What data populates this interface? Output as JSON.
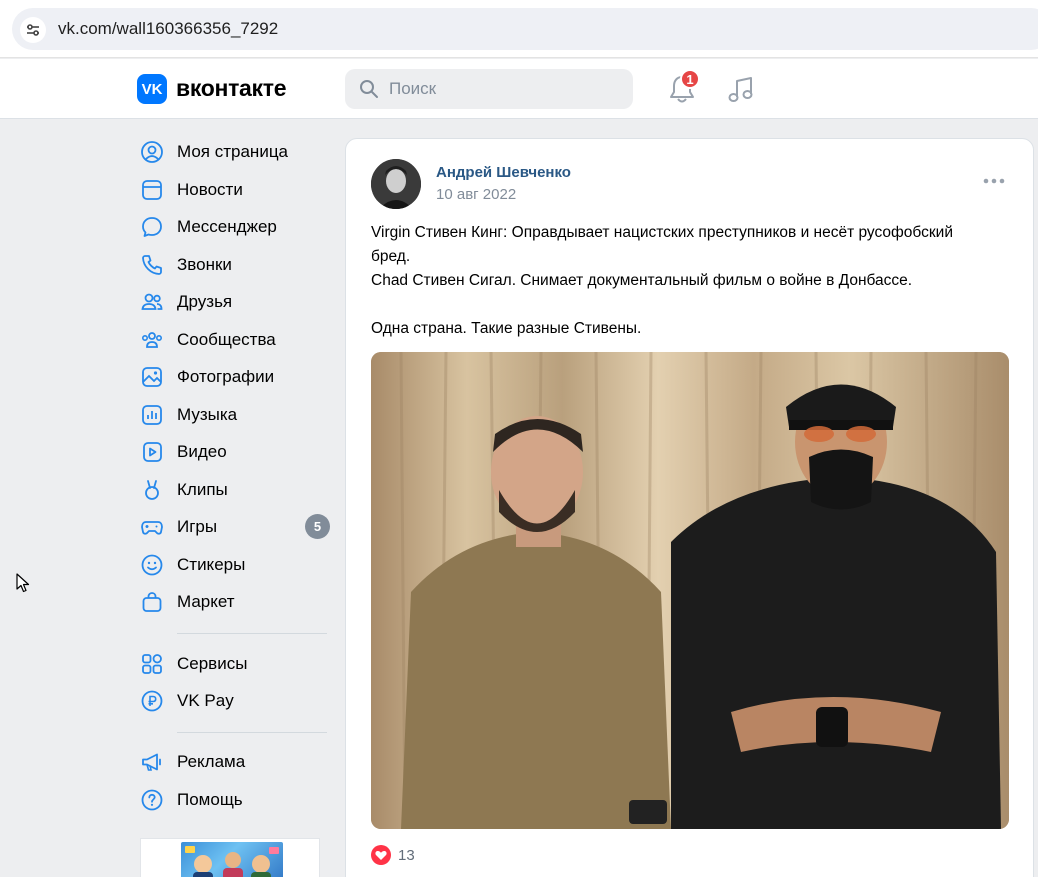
{
  "browser": {
    "url": "vk.com/wall160366356_7292"
  },
  "header": {
    "logo_text": "VK",
    "wordmark": "вконтакте",
    "search_placeholder": "Поиск",
    "notifications_count": "1"
  },
  "sidebar": {
    "items": [
      {
        "label": "Моя страница",
        "icon": "profile-icon"
      },
      {
        "label": "Новости",
        "icon": "news-icon"
      },
      {
        "label": "Мессенджер",
        "icon": "messenger-icon"
      },
      {
        "label": "Звонки",
        "icon": "phone-icon"
      },
      {
        "label": "Друзья",
        "icon": "friends-icon"
      },
      {
        "label": "Сообщества",
        "icon": "communities-icon"
      },
      {
        "label": "Фотографии",
        "icon": "photos-icon"
      },
      {
        "label": "Музыка",
        "icon": "music-icon"
      },
      {
        "label": "Видео",
        "icon": "video-icon"
      },
      {
        "label": "Клипы",
        "icon": "clips-icon"
      },
      {
        "label": "Игры",
        "icon": "games-icon",
        "count": "5"
      },
      {
        "label": "Стикеры",
        "icon": "stickers-icon"
      },
      {
        "label": "Маркет",
        "icon": "market-icon"
      },
      {
        "label": "Сервисы",
        "icon": "services-icon"
      },
      {
        "label": "VK Pay",
        "icon": "vkpay-icon"
      },
      {
        "label": "Реклама",
        "icon": "ads-icon"
      },
      {
        "label": "Помощь",
        "icon": "help-icon"
      }
    ]
  },
  "post": {
    "author": "Андрей Шевченко",
    "date": "10 авг 2022",
    "text_lines": [
      "Virgin Стивен Кинг: Оправдывает нацистских преступников и несёт русофобский",
      "бред.",
      "Chad Стивен Сигал. Снимает документальный фильм о войне в Донбассе.",
      "",
      "Одна страна. Такие разные Стивены."
    ],
    "likes": "13"
  },
  "colors": {
    "vk_blue": "#0077ff",
    "link_blue": "#2a5885",
    "icon_blue": "#2688eb",
    "badge_red": "#e64646",
    "page_bg": "#edeef0"
  }
}
